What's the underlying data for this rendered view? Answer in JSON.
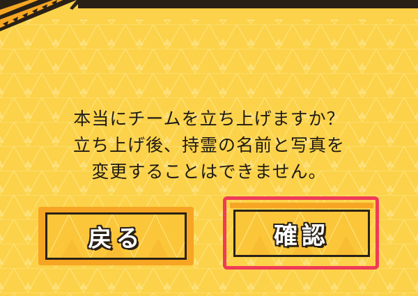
{
  "dialog": {
    "message_lines": [
      "本当にチームを立ち上げますか？",
      "立ち上げ後、持霊の名前と写真を",
      "変更することはできません。"
    ]
  },
  "buttons": {
    "back_label": "戻る",
    "confirm_label": "確認"
  },
  "colors": {
    "background": "#fcd24a",
    "button_face": "#fbc63a",
    "button_frame_orange": "#f6a623",
    "highlight_red": "#ef3b57",
    "text_dark": "#1f1a14"
  }
}
